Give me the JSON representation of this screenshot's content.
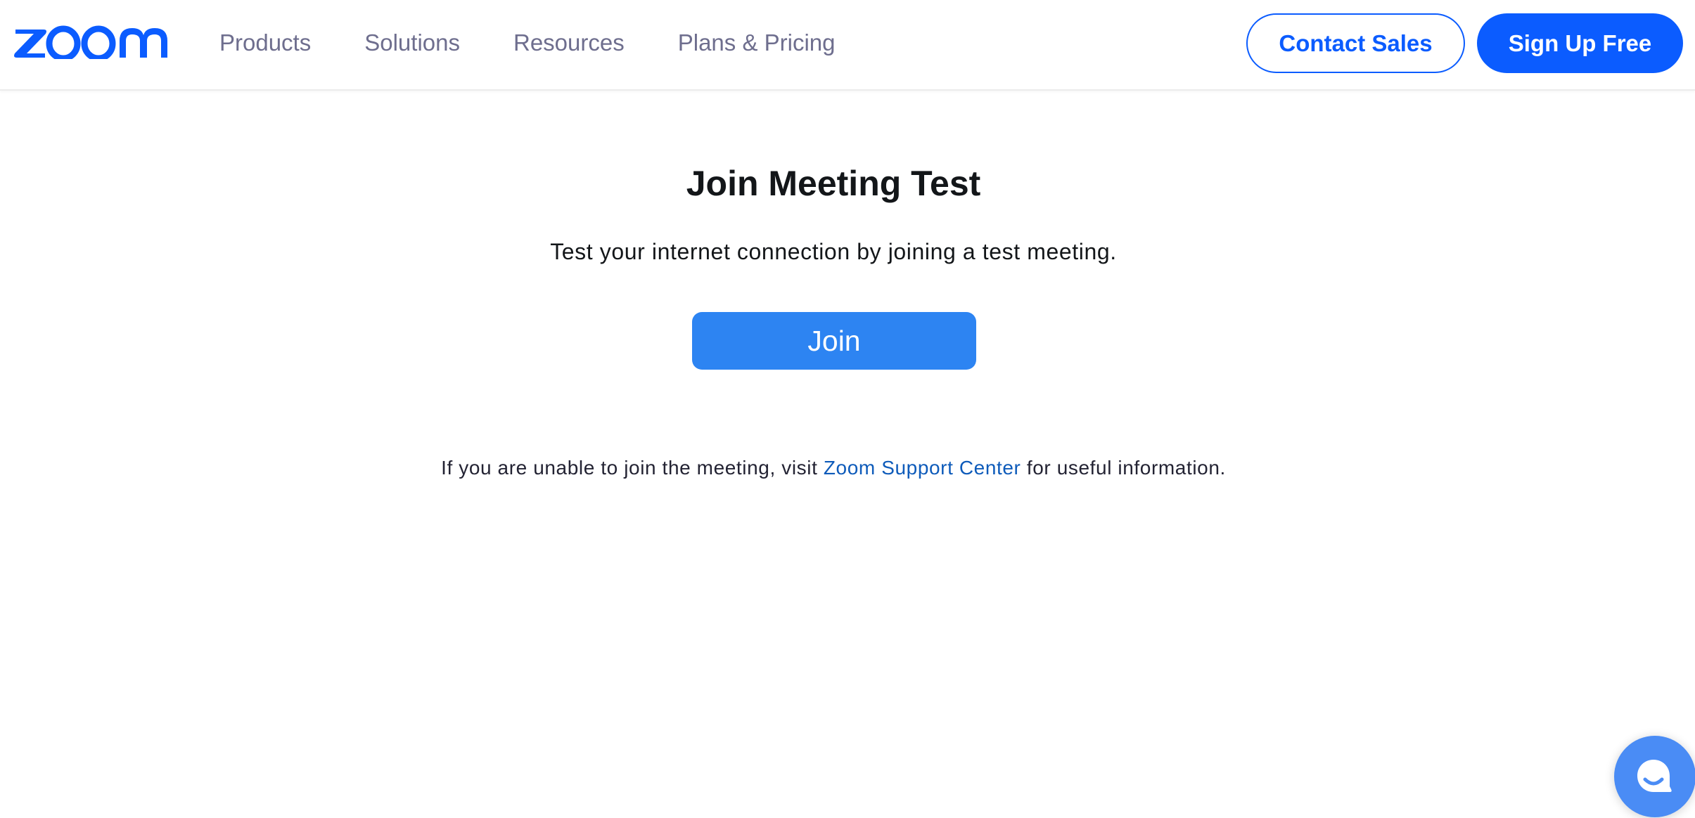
{
  "header": {
    "logo_text": "zoom",
    "nav": [
      {
        "label": "Products"
      },
      {
        "label": "Solutions"
      },
      {
        "label": "Resources"
      },
      {
        "label": "Plans & Pricing"
      }
    ],
    "contact_sales_label": "Contact Sales",
    "sign_up_label": "Sign Up Free"
  },
  "main": {
    "title": "Join Meeting Test",
    "subtitle": "Test your internet connection by joining a test meeting.",
    "join_label": "Join",
    "help": {
      "prefix": "If you are unable to join the meeting, visit ",
      "link_text": "Zoom Support Center",
      "suffix": " for useful information."
    }
  },
  "chat_widget": {
    "icon": "chat-bubble-icon"
  },
  "colors": {
    "brand": "#0b5cff",
    "join_button": "#2d84f2",
    "link": "#0e5bba",
    "nav_text": "#6e6e8e",
    "chat_fab": "#4a8cf5"
  }
}
